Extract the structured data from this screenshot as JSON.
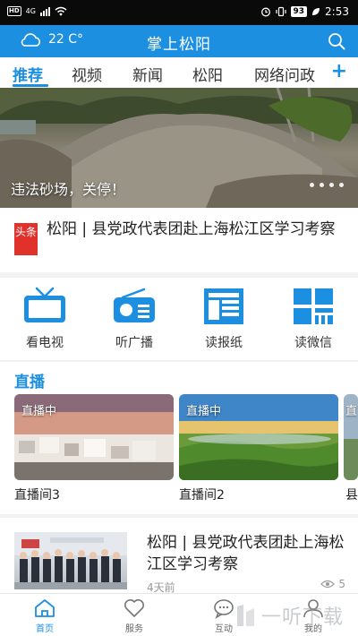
{
  "status_bar": {
    "network_badge": "HD",
    "network_type": "4G",
    "battery": "93",
    "time": "2:53"
  },
  "header": {
    "weather_temp": "22 C°",
    "title": "掌上松阳",
    "weather_icon": "cloud-icon",
    "search_icon": "search-icon"
  },
  "tabs": [
    "推荐",
    "视频",
    "新闻",
    "松阳",
    "网络问政"
  ],
  "tabs_add": "+",
  "banner": {
    "caption": "违法砂场，关停！"
  },
  "headline": {
    "badge": "头条",
    "text": "松阳 | 县党政代表团赴上海松江区学习考察"
  },
  "quick_links": [
    {
      "label": "看电视",
      "icon": "tv-icon"
    },
    {
      "label": "听广播",
      "icon": "radio-icon"
    },
    {
      "label": "读报纸",
      "icon": "newspaper-icon"
    },
    {
      "label": "读微信",
      "icon": "wechat-article-icon"
    }
  ],
  "live": {
    "title": "直播",
    "cards": [
      {
        "badge": "直播中",
        "name": "直播间3"
      },
      {
        "badge": "直播中",
        "name": "直播间2"
      },
      {
        "badge": "直",
        "name": "县"
      }
    ]
  },
  "news": {
    "title": "松阳 | 县党政代表团赴上海松江区学习考察",
    "time": "4天前",
    "views": "5"
  },
  "bottom_nav": [
    {
      "label": "首页",
      "icon": "home-icon",
      "active": true
    },
    {
      "label": "服务",
      "icon": "heart-icon",
      "active": false
    },
    {
      "label": "互动",
      "icon": "chat-bubble-icon",
      "active": false
    },
    {
      "label": "我的",
      "icon": "user-icon",
      "active": false
    }
  ],
  "watermark": "一听下载",
  "colors": {
    "accent": "#1c8fe0",
    "headline_badge": "#e0322b"
  }
}
